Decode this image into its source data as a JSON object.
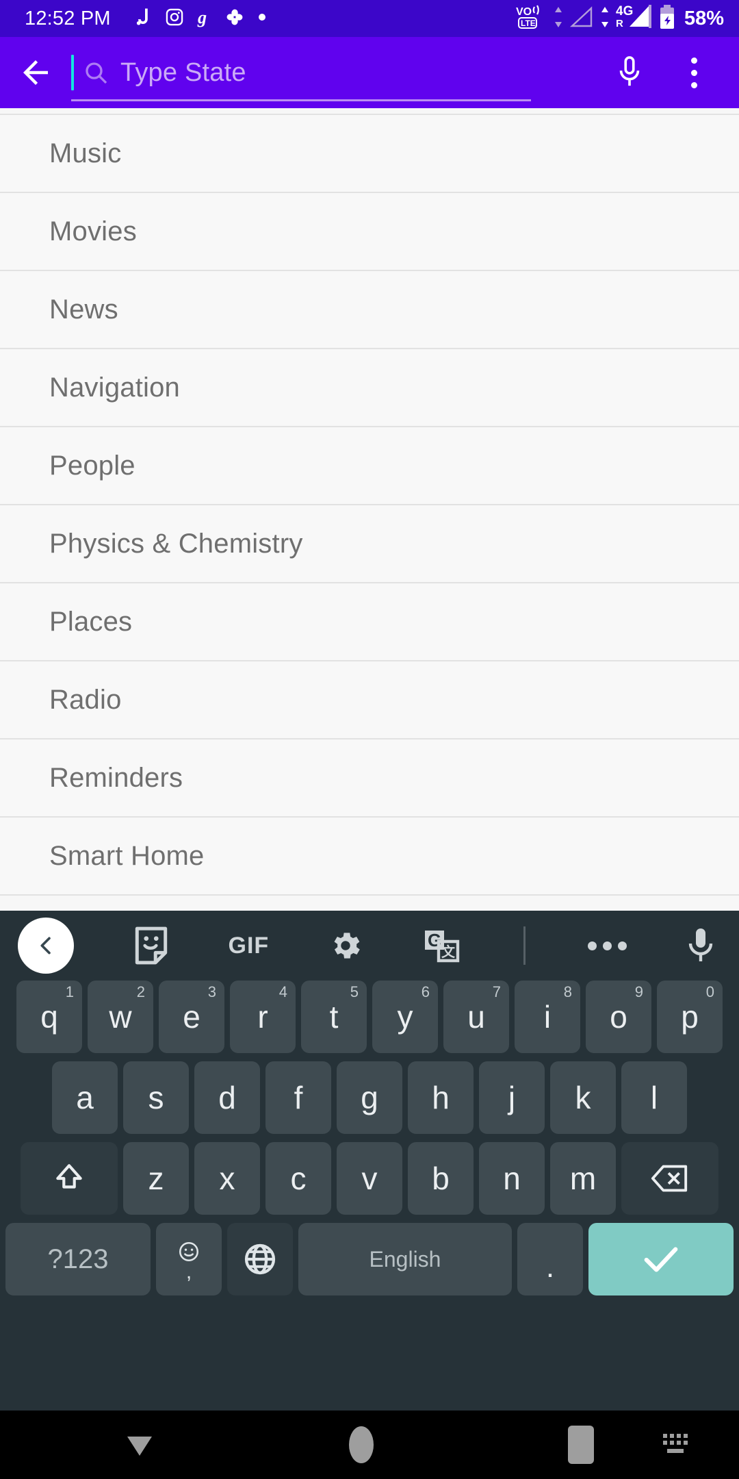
{
  "status_bar": {
    "time": "12:52 PM",
    "notification_icons": [
      "shazam-icon",
      "instagram-icon",
      "goodreads-icon",
      "google-photos-icon",
      "dot-icon"
    ],
    "network_icons": [
      "volte-icon",
      "data-transfer-icon",
      "signal-bars-icon",
      "4g-roaming-icon",
      "battery-charging-icon"
    ],
    "network_label": "4G",
    "roaming_label": "R",
    "volte_label_top": "VO",
    "volte_label_bottom": "LTE",
    "battery_percent": "58%",
    "background_color": "#3C06C9"
  },
  "app_bar": {
    "back_icon": "arrow-back-icon",
    "search_icon": "search-icon",
    "search_value": "",
    "search_placeholder": "Type State",
    "mic_icon": "microphone-icon",
    "overflow_icon": "more-vert-icon",
    "background_color": "#6002EE",
    "caret_color": "#12E6E0"
  },
  "list": {
    "items": [
      {
        "label": "Music"
      },
      {
        "label": "Movies"
      },
      {
        "label": "News"
      },
      {
        "label": "Navigation"
      },
      {
        "label": "People"
      },
      {
        "label": "Physics & Chemistry"
      },
      {
        "label": "Places"
      },
      {
        "label": "Radio"
      },
      {
        "label": "Reminders"
      },
      {
        "label": "Smart Home"
      }
    ]
  },
  "keyboard": {
    "toolbar": [
      {
        "name": "collapse-toolbar-icon",
        "label": ""
      },
      {
        "name": "sticker-icon",
        "label": ""
      },
      {
        "name": "gif-icon",
        "label": "GIF"
      },
      {
        "name": "settings-gear-icon",
        "label": ""
      },
      {
        "name": "translate-icon",
        "label": ""
      },
      {
        "name": "more-options-icon",
        "label": ""
      },
      {
        "name": "voice-input-icon",
        "label": ""
      }
    ],
    "row1": [
      {
        "key": "q",
        "hint": "1"
      },
      {
        "key": "w",
        "hint": "2"
      },
      {
        "key": "e",
        "hint": "3"
      },
      {
        "key": "r",
        "hint": "4"
      },
      {
        "key": "t",
        "hint": "5"
      },
      {
        "key": "y",
        "hint": "6"
      },
      {
        "key": "u",
        "hint": "7"
      },
      {
        "key": "i",
        "hint": "8"
      },
      {
        "key": "o",
        "hint": "9"
      },
      {
        "key": "p",
        "hint": "0"
      }
    ],
    "row2": [
      {
        "key": "a"
      },
      {
        "key": "s"
      },
      {
        "key": "d"
      },
      {
        "key": "f"
      },
      {
        "key": "g"
      },
      {
        "key": "h"
      },
      {
        "key": "j"
      },
      {
        "key": "k"
      },
      {
        "key": "l"
      }
    ],
    "row3": [
      {
        "key": "z"
      },
      {
        "key": "x"
      },
      {
        "key": "c"
      },
      {
        "key": "v"
      },
      {
        "key": "b"
      },
      {
        "key": "n"
      },
      {
        "key": "m"
      }
    ],
    "shift_icon": "shift-icon",
    "backspace_icon": "backspace-icon",
    "symbols_label": "?123",
    "emoji_icon": "emoji-icon",
    "comma_label": ",",
    "language_icon": "globe-language-icon",
    "space_label": "English",
    "period_label": ".",
    "enter_icon": "checkmark-enter-icon",
    "enter_color": "#80CBC4",
    "background_color": "#263238",
    "key_color": "#3F4B51"
  },
  "nav_bar": {
    "back_icon": "keyboard-dismiss-icon",
    "home_icon": "home-icon",
    "recents_icon": "recents-icon",
    "switch_keyboard_icon": "switch-keyboard-icon",
    "background_color": "#000000"
  }
}
